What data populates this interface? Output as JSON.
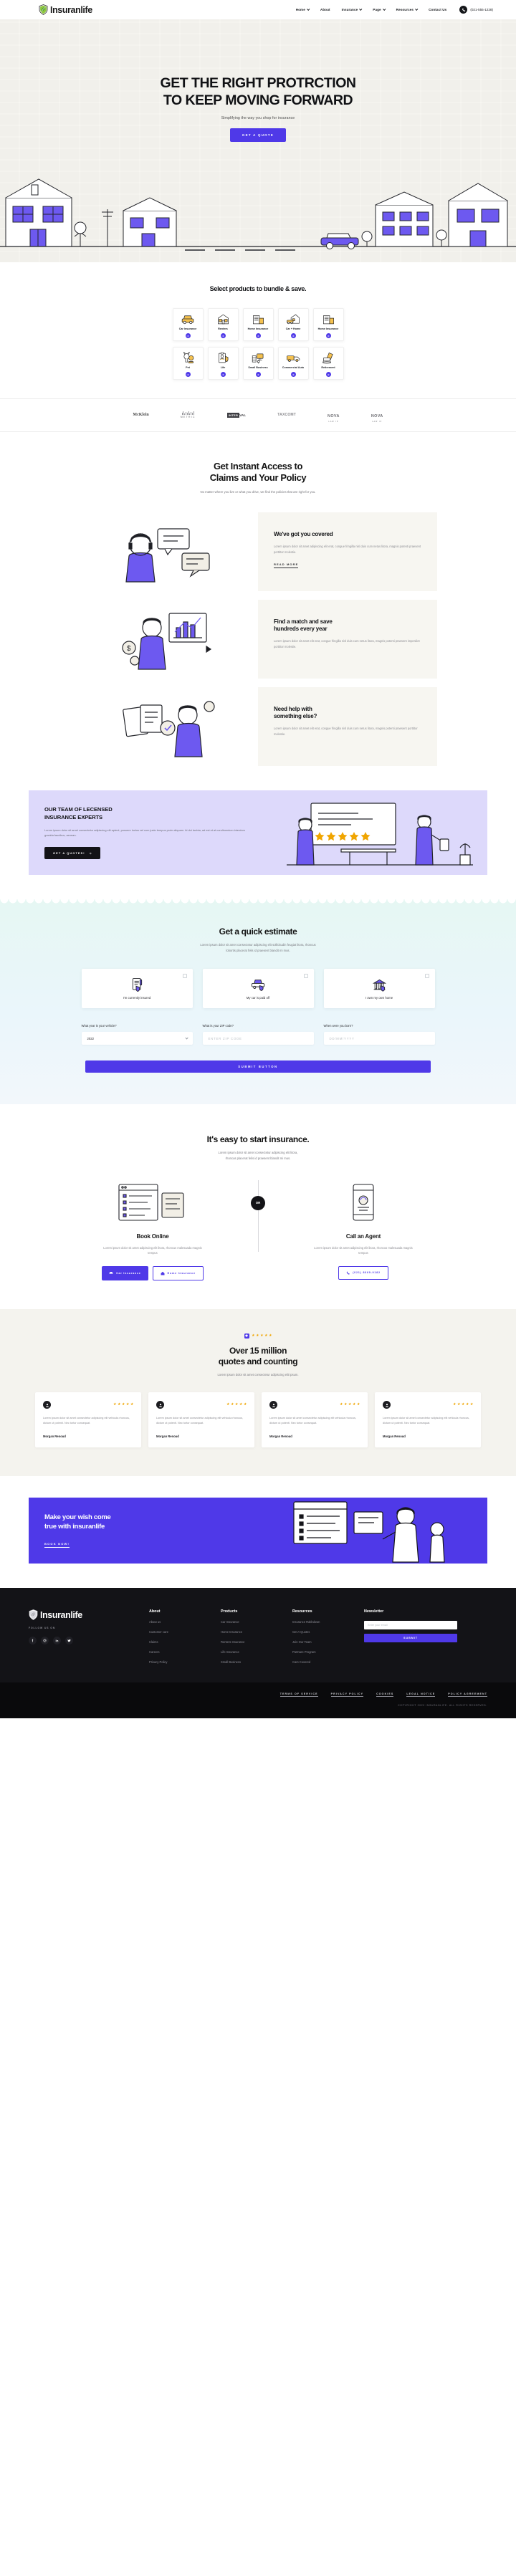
{
  "brand": {
    "name": "Insuranlife",
    "logo_icon": "shield-leaf-logo"
  },
  "nav": {
    "items": [
      {
        "label": "Home",
        "has_dropdown": true
      },
      {
        "label": "About",
        "has_dropdown": false
      },
      {
        "label": "Insurance",
        "has_dropdown": true
      },
      {
        "label": "Page",
        "has_dropdown": true
      },
      {
        "label": "Resources",
        "has_dropdown": true
      },
      {
        "label": "Contact Us",
        "has_dropdown": false
      }
    ],
    "phone": "(021-555-1228)",
    "phone_icon": "phone-ring-icon"
  },
  "hero": {
    "title_line1": "GET THE RIGHT PROTRCTION",
    "title_line2": "TO KEEP MOVING FORWARD",
    "subtitle": "Simplifying the way you shop for insurance",
    "cta": "GET A QUOTE"
  },
  "bundle": {
    "title": "Select products to bundle & save.",
    "cards": [
      {
        "label": "Car Insurance",
        "icon": "car-icon"
      },
      {
        "label": "Renters",
        "icon": "renters-building-icon"
      },
      {
        "label": "Home Insurance",
        "icon": "home-building-icon"
      },
      {
        "label": "Car + Home",
        "icon": "car-home-icon"
      },
      {
        "label": "Home Insurance",
        "icon": "home-building-icon"
      },
      {
        "label": "Pet",
        "icon": "pet-dog-icon"
      },
      {
        "label": "Life",
        "icon": "life-clipboard-icon"
      },
      {
        "label": "Small Business",
        "icon": "desk-computer-icon"
      },
      {
        "label": "Commercial Auto",
        "icon": "truck-icon"
      },
      {
        "label": "Retirement",
        "icon": "retirement-chair-icon"
      }
    ],
    "arrow_icon": "arrow-right-icon"
  },
  "logos": [
    {
      "name": "McKlein",
      "style": "serif"
    },
    {
      "name": "METRIC",
      "style": "metric"
    },
    {
      "name": "INTERVAL",
      "style": "interval"
    },
    {
      "name": "TAXCOMT",
      "style": "tax"
    },
    {
      "name": "NOVA",
      "sub": "LAW IP",
      "style": "nova"
    },
    {
      "name": "NOVA",
      "sub": "LAW IP",
      "style": "nova"
    }
  ],
  "access": {
    "title_line1": "Get Instant Access to",
    "title_line2": "Claims and Your Policy",
    "subtitle": "No matter where you live or what you drive, we find the policies that are right for you.",
    "features": [
      {
        "art": "customer-support-chat-illustration",
        "heading": "We've got you covered",
        "body": "Lorem ipsum dolor sit amet adipiscing elit erat, congue fringilla nisl duis cum netus litora, magnis potenti praesent porttitor molestie.",
        "link": "READ MORE",
        "has_link": true
      },
      {
        "art": "savings-chart-illustration",
        "heading_line1": "Find a match and save",
        "heading_line2": "hundreds every year",
        "body": "Lorem ipsum dolor sit amet elit erat, congue fringilla nisl duis cum netus litora, magnis potenti praesent imperdiet porttitor molestie.",
        "has_link": false
      },
      {
        "art": "documents-help-illustration",
        "heading_line1": "Need help with",
        "heading_line2": "something else?",
        "body": "Lorem ipsum dolor sit amet elit erat, congue fringilla nisl duis cum netus litora, magnis potenti praesent porttitor molestie.",
        "has_link": false
      }
    ]
  },
  "experts": {
    "title_line1": "OUR TEAM OF LECENSED",
    "title_line2": "INSURANCE EXPERTS",
    "body": "Lorem ipsum dolor sit amet consectetur adipiscing elit aptent, posuere luctus vel cum justo tempus proin aliquam. Id dui lacinia, ad est et at condimentum interdum gravida faucibus, aenean.",
    "cta": "GET A QUOTES!",
    "art": "team-meeting-illustration",
    "bg_color": "#ddd9fb"
  },
  "estimate": {
    "title": "Get a quick estimate",
    "subtitle_line1": "Lorem ipsum dolor sit amet consectetur adipiscing elit sollicitudin feugiat litora, rhoncus",
    "subtitle_line2": "lobortis placerat felis id praesent blandit mi mus.",
    "options": [
      {
        "label": "I'm currently insured",
        "icon": "policy-document-icon",
        "checked": false
      },
      {
        "label": "My car is paid off",
        "icon": "car-shield-icon",
        "checked": false
      },
      {
        "label": "I own my own home",
        "icon": "home-bank-icon",
        "checked": false
      }
    ],
    "fields": [
      {
        "label": "What year is your vehicle?",
        "type": "select",
        "value": "2022"
      },
      {
        "label": "What is your ZIP code?",
        "type": "text",
        "value": "",
        "placeholder": "ENTER ZIP CODE"
      },
      {
        "label": "When were you born?",
        "type": "text",
        "value": "",
        "placeholder": "DD/MM/YYYY"
      }
    ],
    "submit": "SUBMIT BUTTON"
  },
  "easy": {
    "title": "It's easy to start insurance.",
    "subtitle_line1": "Lorem ipsum dolor sit amet consectetur adipiscing elit litora,",
    "subtitle_line2": "rhoncus placerat felis id praesent blandit mi mus.",
    "divider": "OR",
    "columns": [
      {
        "art": "online-form-illustration",
        "heading": "Book Online",
        "body": "Lorem ipsum dolor sit amet adipiscing elit litora, rhoncus malesuada magnis tempus",
        "buttons": [
          {
            "label": "Car Insurance",
            "style": "filled",
            "icon": "car-small-icon"
          },
          {
            "label": "Home Insurance",
            "style": "outline",
            "icon": "home-small-icon"
          }
        ]
      },
      {
        "art": "agent-phone-illustration",
        "heading": "Call an Agent",
        "body": "Lorem ipsum dolor sit amet adipiscing elit litora, rhoncus malesuada magnis tempus",
        "buttons": [
          {
            "label": "(021) 8669-9182",
            "style": "outline",
            "icon": "phone-small-icon"
          }
        ]
      }
    ]
  },
  "quotes": {
    "badge_icon": "brand-badge-icon",
    "rating_stars": 5,
    "title_line1": "Over 15 million",
    "title_line2": "quotes and counting",
    "subtitle": "Lorem ipsum dolor sit amet consectetur adipiscing elit ipsum.",
    "testimonials": [
      {
        "stars": 5,
        "body": "Lorem ipsum dolor sit amet consectetur adipiscing elit vehicula rhoncus, dictum ut potenti. Nec tortor consequat.",
        "name": "Morgan Renoud",
        "avatar_icon": "avatar-icon"
      },
      {
        "stars": 5,
        "body": "Lorem ipsum dolor sit amet consectetur adipiscing elit vehicula rhoncus, dictum ut potenti. Nec tortor consequat.",
        "name": "Morgan Renoud",
        "avatar_icon": "avatar-icon"
      },
      {
        "stars": 5,
        "body": "Lorem ipsum dolor sit amet consectetur adipiscing elit vehicula rhoncus, dictum ut potenti. Nec tortor consequat.",
        "name": "Morgan Renoud",
        "avatar_icon": "avatar-icon"
      },
      {
        "stars": 5,
        "body": "Lorem ipsum dolor sit amet consectetur adipiscing elit vehicula rhoncus, dictum ut potenti. Nec tortor consequat.",
        "name": "Morgan Renoud",
        "avatar_icon": "avatar-icon"
      }
    ]
  },
  "wish": {
    "title_line1": "Make your wish come",
    "title_line2": "true with insuranlife",
    "cta": "BOOK NOW!",
    "art": "agent-checklist-illustration",
    "bg_color": "#4f39e8"
  },
  "footer": {
    "brand": "Insuranlife",
    "follow_label": "FOLLOW US ON",
    "socials": [
      {
        "icon": "facebook-icon",
        "glyph": "f"
      },
      {
        "icon": "instagram-icon",
        "glyph": "▢"
      },
      {
        "icon": "linkedin-icon",
        "glyph": "in"
      },
      {
        "icon": "twitter-icon",
        "glyph": "✈"
      }
    ],
    "columns": [
      {
        "title": "About",
        "links": [
          "About us",
          "Customer care",
          "Claims",
          "Careers",
          "Privacy Policy"
        ]
      },
      {
        "title": "Products",
        "links": [
          "Car Insurance",
          "Home Insurance",
          "Renters Insurance",
          "Life Insurance",
          "Small Business"
        ]
      },
      {
        "title": "Resources",
        "links": [
          "Insurance Rakhdown",
          "Get A Quotes",
          "Join Our Team",
          "Partnare Program",
          "Cars Covered"
        ]
      }
    ],
    "newsletter": {
      "title": "Newsletter",
      "placeholder": "Enter your email",
      "button": "SUBMIT"
    },
    "legal": [
      "TERMS OF SERVICE",
      "PRIVACY POLICY",
      "COOKIES",
      "LEGAL NOTICE",
      "POLICY AGREEMENT"
    ],
    "copyright": "COPYRIGHT 2022 INSURANLIFE. ALL RIGHTS RESERVED."
  },
  "colors": {
    "accent": "#4f39e8",
    "hero_bg": "#f7f6f1",
    "experts_bg": "#ddd9fb",
    "dark": "#131317",
    "star": "#f0a500"
  }
}
